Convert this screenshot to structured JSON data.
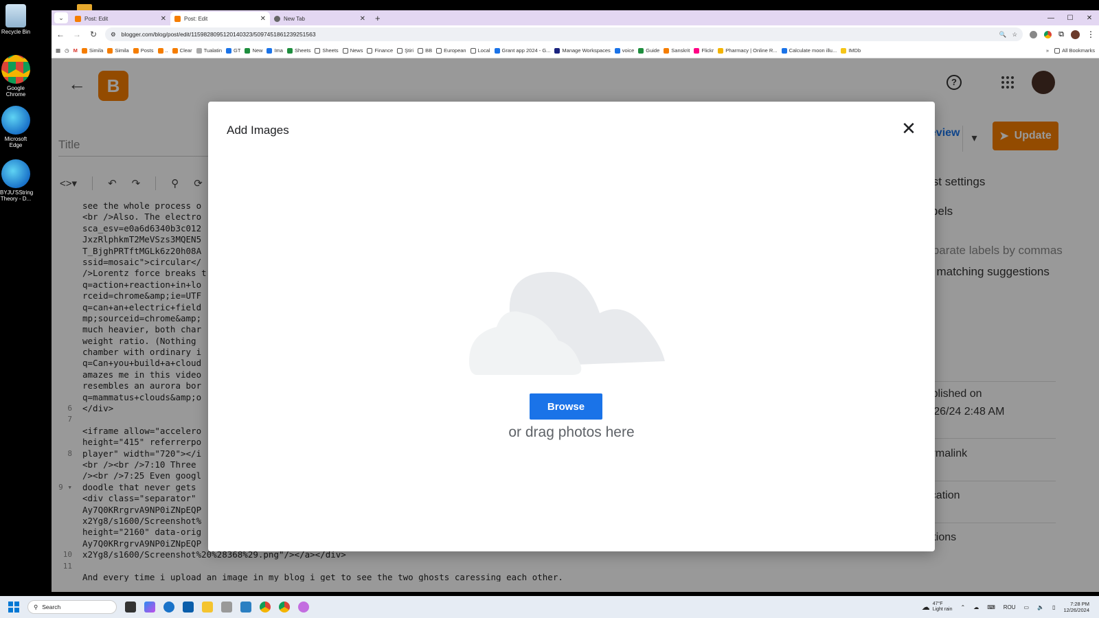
{
  "desktop": {
    "icons": [
      {
        "label": "Recycle Bin"
      },
      {
        "label": "Google Chrome"
      },
      {
        "label": "Microsoft Edge"
      },
      {
        "label": "BYJU'SString Theory - D..."
      }
    ]
  },
  "browser": {
    "tabs": [
      {
        "title": "Post: Edit"
      },
      {
        "title": "Post: Edit"
      },
      {
        "title": "New Tab"
      }
    ],
    "url": "blogger.com/blog/post/edit/1159828095120140323/5097451861239251563",
    "bookmarks": [
      "Simila",
      "Simila",
      "Posts",
      "..",
      "Clear",
      "Tualatin",
      "GT",
      "New",
      "Ima",
      "Sheets",
      "Sheets",
      "News",
      "Finance",
      "Ştiri",
      "BB",
      "European",
      "Local",
      "Grant app 2024 - G...",
      "Manage Workspaces",
      "voice",
      "Guide",
      "Sanskrit",
      "Flickr",
      "Pharmacy | Online R...",
      "Calculate moon illu...",
      "IMDb"
    ],
    "all_bookmarks": "All Bookmarks"
  },
  "blogger": {
    "title_placeholder": "Title",
    "preview_label": "Preview",
    "update_label": "Update",
    "side": {
      "settings": "Post settings",
      "labels": "Labels",
      "labels_hint": "Separate labels by commas",
      "no_match": "No matching suggestions",
      "published_on": "Published on",
      "published_date": "12/26/24 2:48 AM",
      "permalink": "Permalink",
      "location": "Location",
      "options": "Options"
    },
    "gutter": [
      "",
      "",
      "",
      "",
      "",
      "",
      "",
      "",
      "",
      "",
      "",
      "",
      "",
      "",
      "",
      "",
      "",
      "",
      "6",
      "7",
      "",
      "",
      "8",
      "",
      "",
      "9 ▾",
      "",
      "",
      "",
      "",
      "",
      "10",
      "11"
    ],
    "code_lines": [
      "see the whole process o",
      "<br />Also. The electro",
      "sca_esv=e0a6d6340b3c012",
      "JxzRlphkmT2MeVSzs3MQEN5",
      "T_BjghPRTftMGLk6z20h08A",
      "ssid=mosaic\">circular</",
      "/>Lorentz force breaks t",
      "q=action+reaction+in+lo",
      "rceid=chrome&amp;ie=UTF",
      "q=can+an+electric+field",
      "mp;sourceid=chrome&amp;",
      "much heavier, both char",
      "weight ratio. (Nothing ",
      "chamber with ordinary i",
      "q=Can+you+build+a+cloud",
      "amazes me in this video",
      "resembles an aurora bor",
      "q=mammatus+clouds&amp;o",
      "</div>",
      "",
      "<iframe allow=\"accelero",
      "height=\"415\" referrerpo",
      "player\" width=\"720\"></i",
      "<br /><br />7:10 Three ",
      "/><br />7:25 Even googl",
      "doodle that never gets ",
      "<div class=\"separator\" ",
      "Ay7Q0KRrgrvA9NP0iZNpEQP",
      "x2Yg8/s1600/Screenshot%",
      "height=\"2160\" data-orig",
      "Ay7Q0KRrgrvA9NP0iZNpEQP",
      "x2Yg8/s1600/Screenshot%20%28368%29.png\"/></a></div>",
      "",
      "And every time i upload an image in my blog i get to see the two ghosts caressing each other."
    ]
  },
  "dialog": {
    "title": "Add Images",
    "browse_label": "Browse",
    "drag_text": "or drag photos here"
  },
  "taskbar": {
    "search_placeholder": "Search",
    "weather_temp": "47°F",
    "weather_desc": "Light rain",
    "lang": "ROU",
    "time": "7:28 PM",
    "date": "12/26/2024"
  },
  "colors": {
    "blogger_orange": "#f57d00",
    "browse_blue": "#1a73e8"
  }
}
